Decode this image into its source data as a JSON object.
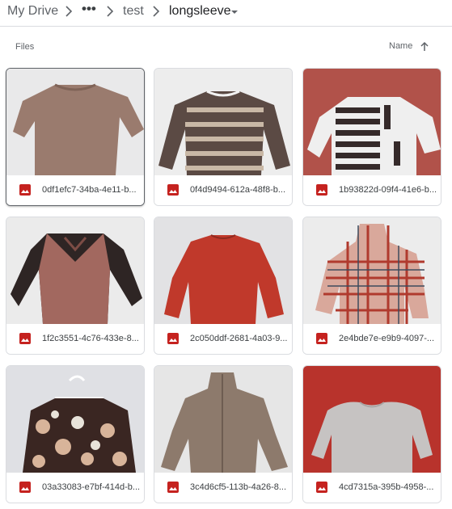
{
  "breadcrumb": {
    "root": "My Drive",
    "more": "•••",
    "folder": "test",
    "current": "longsleeve"
  },
  "section": {
    "label": "Files",
    "sort_label": "Name"
  },
  "colors": {
    "image_icon": "#c5221f",
    "border": "#dadce0",
    "text": "#3c4043"
  },
  "files": [
    {
      "name": "0df1efc7-34ba-4e11-b...",
      "icon": "image-icon"
    },
    {
      "name": "0f4d9494-612a-48f8-b...",
      "icon": "image-icon"
    },
    {
      "name": "1b93822d-09f4-41e6-b...",
      "icon": "image-icon"
    },
    {
      "name": "1f2c3551-4c76-433e-8...",
      "icon": "image-icon"
    },
    {
      "name": "2c050ddf-2681-4a03-9...",
      "icon": "image-icon"
    },
    {
      "name": "2e4bde7e-e9b9-4097-...",
      "icon": "image-icon"
    },
    {
      "name": "03a33083-e7bf-414d-b...",
      "icon": "image-icon"
    },
    {
      "name": "3c4d6cf5-113b-4a26-8...",
      "icon": "image-icon"
    },
    {
      "name": "4cd7315a-395b-4958-...",
      "icon": "image-icon"
    }
  ]
}
